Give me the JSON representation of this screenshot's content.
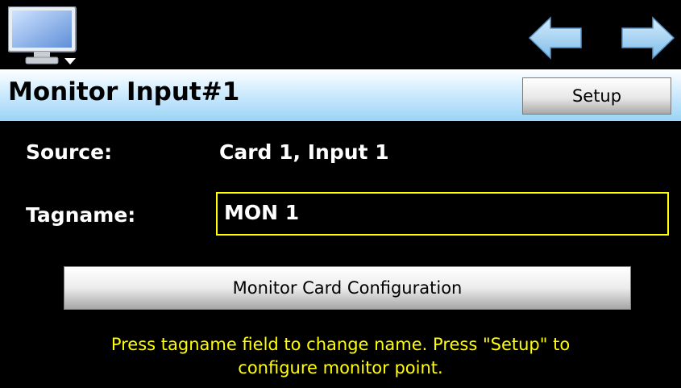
{
  "topbar": {
    "monitor_icon": "monitor-icon",
    "back_icon": "arrow-left-icon",
    "forward_icon": "arrow-right-icon"
  },
  "header": {
    "title": "Monitor Input#1",
    "setup_label": "Setup"
  },
  "fields": {
    "source_label": "Source:",
    "source_value": "Card 1, Input 1",
    "tagname_label": "Tagname:",
    "tagname_value": "MON 1"
  },
  "actions": {
    "config_label": "Monitor Card Configuration"
  },
  "hint": {
    "line1": "Press tagname field to change name.  Press \"Setup\" to",
    "line2": "configure monitor point."
  },
  "colors": {
    "background": "#000000",
    "header_gradient_top": "#ffffff",
    "header_gradient_bottom": "#9bd3f6",
    "field_border": "#ffff00",
    "hint_text": "#ffff00",
    "arrow_fill": "#9fd1f4"
  }
}
